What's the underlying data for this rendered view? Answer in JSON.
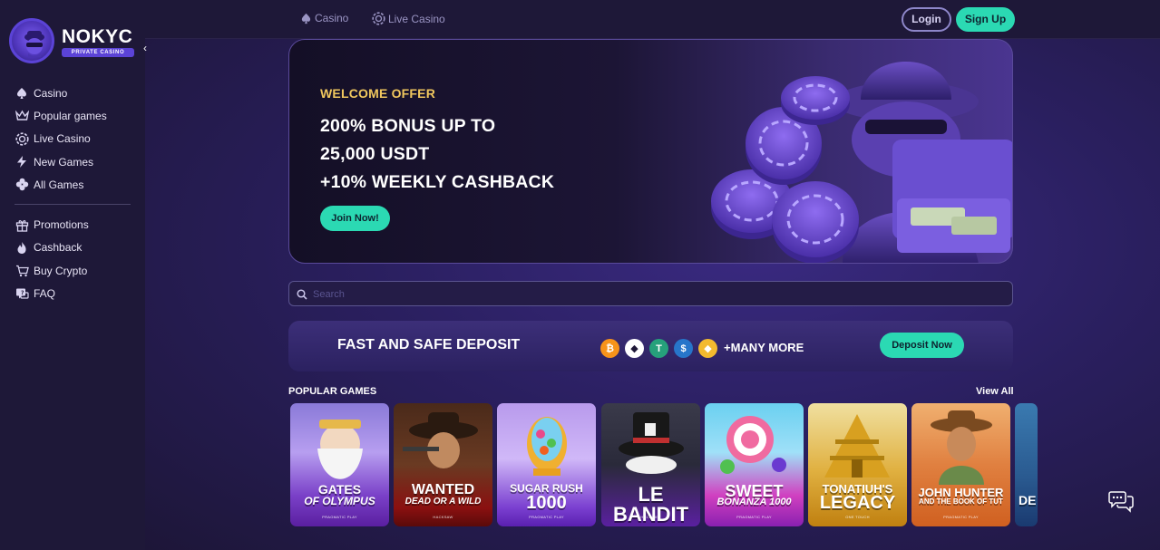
{
  "brand": {
    "title": "NOKYC",
    "subtitle": "PRIVATE CASINO"
  },
  "sidebar": {
    "collapse_icon": "chevron-left-icon",
    "primary": [
      {
        "label": "Casino",
        "icon": "spade-icon"
      },
      {
        "label": "Popular games",
        "icon": "crown-icon"
      },
      {
        "label": "Live Casino",
        "icon": "chip-icon"
      },
      {
        "label": "New Games",
        "icon": "lightning-icon"
      },
      {
        "label": "All Games",
        "icon": "clover-icon"
      }
    ],
    "secondary": [
      {
        "label": "Promotions",
        "icon": "gift-icon"
      },
      {
        "label": "Cashback",
        "icon": "flame-icon"
      },
      {
        "label": "Buy Crypto",
        "icon": "cart-icon"
      },
      {
        "label": "FAQ",
        "icon": "chat-question-icon"
      }
    ]
  },
  "header": {
    "links": [
      {
        "label": "Casino",
        "icon": "spade-icon"
      },
      {
        "label": "Live Casino",
        "icon": "chip-icon"
      }
    ],
    "login_label": "Login",
    "signup_label": "Sign Up"
  },
  "banner": {
    "eyebrow": "WELCOME OFFER",
    "line1": "200% BONUS UP TO",
    "line2": "25,000 USDT",
    "line3": "+10% WEEKLY CASHBACK",
    "cta_label": "Join Now!"
  },
  "search": {
    "placeholder": "Search",
    "value": ""
  },
  "deposit": {
    "title": "FAST AND SAFE DEPOSIT",
    "coins": [
      {
        "name": "bitcoin-icon",
        "symbol": "₿",
        "color": "#f7931a"
      },
      {
        "name": "ethereum-icon",
        "symbol": "◆",
        "color": "#ffffff"
      },
      {
        "name": "tether-icon",
        "symbol": "T",
        "color": "#26a17b"
      },
      {
        "name": "usdc-icon",
        "symbol": "$",
        "color": "#2775ca"
      },
      {
        "name": "bnb-icon",
        "symbol": "◆",
        "color": "#f3ba2f"
      }
    ],
    "more_label": "+MANY MORE",
    "cta_label": "Deposit Now"
  },
  "popular": {
    "title": "POPULAR GAMES",
    "view_all_label": "View All",
    "games": [
      {
        "line1": "GATES",
        "line2": "OF OLYMPUS",
        "provider": "PRAGMATIC PLAY"
      },
      {
        "line1": "WANTED",
        "line2": "DEAD OR A WILD",
        "provider": "HACKSAW"
      },
      {
        "line1": "SUGAR RUSH",
        "line2": "1000",
        "provider": "PRAGMATIC PLAY"
      },
      {
        "line1": "LE BANDIT",
        "line2": "",
        "provider": "HACKSAW"
      },
      {
        "line1": "SWEET",
        "line2": "BONANZA 1000",
        "provider": "PRAGMATIC PLAY"
      },
      {
        "line1": "TONATIUH'S",
        "line2": "LEGACY",
        "provider": "ONE TOUCH"
      },
      {
        "line1": "JOHN HUNTER",
        "line2": "AND THE BOOK OF TUT",
        "provider": "PRAGMATIC PLAY"
      },
      {
        "line1": "DE",
        "line2": "",
        "provider": ""
      }
    ]
  },
  "colors": {
    "accent": "#2bd9b3",
    "gold": "#f0c75e",
    "sidebar_bg": "#1e1838",
    "page_bg": "#2a1f5f"
  },
  "chat": {
    "icon": "chat-bubbles-icon"
  }
}
